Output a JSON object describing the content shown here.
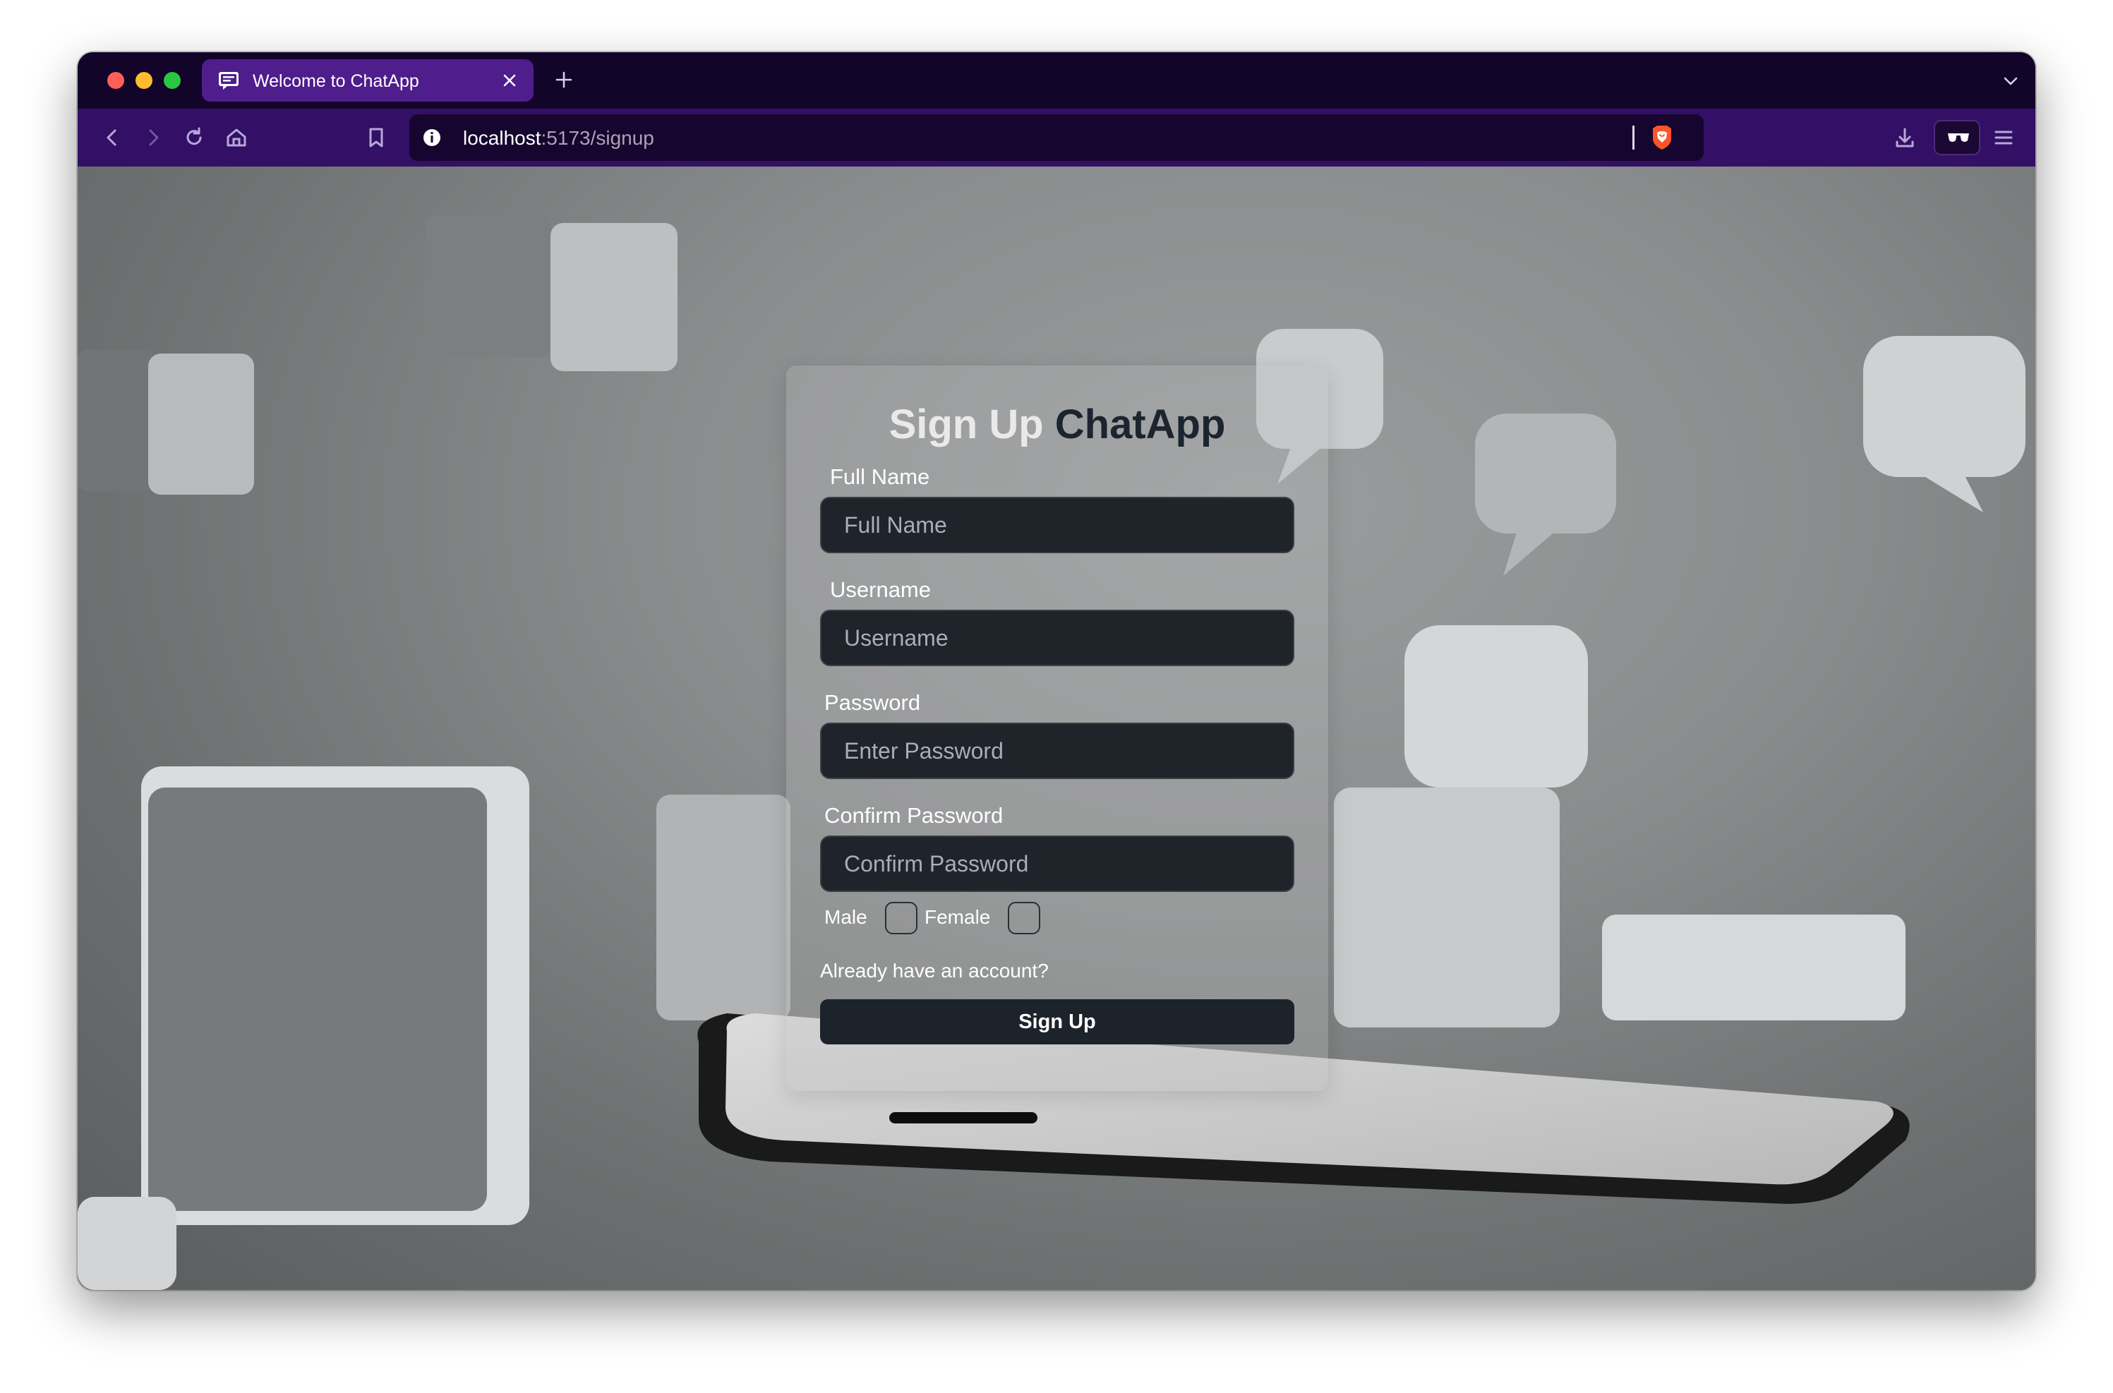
{
  "browser": {
    "tab": {
      "title": "Welcome to ChatApp"
    },
    "url": {
      "host": "localhost",
      "path": ":5173/signup"
    }
  },
  "form": {
    "title_part1": "Sign Up",
    "title_part2": "ChatApp",
    "full_name": {
      "label": "Full Name",
      "placeholder": "Full Name"
    },
    "username": {
      "label": "Username",
      "placeholder": "Username"
    },
    "password": {
      "label": "Password",
      "placeholder": "Enter Password"
    },
    "confirm_password": {
      "label": "Confirm Password",
      "placeholder": "Confirm Password"
    },
    "gender": {
      "male_label": "Male",
      "female_label": "Female"
    },
    "login_link": "Already have an account?",
    "submit_label": "Sign Up"
  },
  "icons": {
    "favicon": "chat-window-icon",
    "back": "chevron-left-icon",
    "forward": "chevron-right-icon",
    "reload": "reload-icon",
    "home": "home-icon",
    "bookmark": "bookmark-icon",
    "site_info": "info-icon",
    "brave": "brave-lion-icon",
    "download": "download-icon",
    "reader": "reader-mode-icon",
    "menu": "hamburger-menu-icon"
  },
  "colors": {
    "tab_active": "#4f1d8c",
    "toolbar": "#330f66",
    "card_input_bg": "#1f232a",
    "title_dark": "#1c2430"
  }
}
